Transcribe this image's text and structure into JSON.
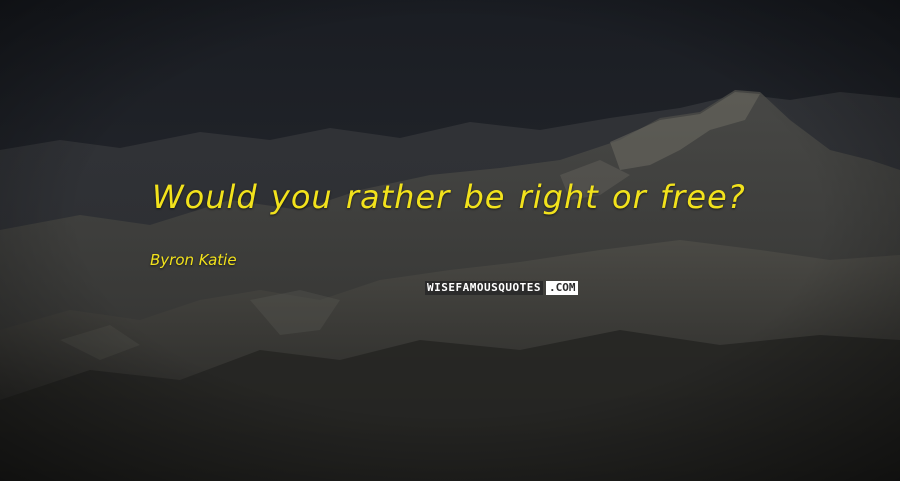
{
  "quote": {
    "text": "Would you rather be right or free?",
    "color": "#f2e21c"
  },
  "author": {
    "name": "Byron Katie",
    "color": "#f2e21c"
  },
  "watermark": {
    "brand": "WISEFAMOUSQUOTES",
    "tld": ".COM",
    "text_color": "#ffffff",
    "highlight_color": "#ffffff",
    "background": "#2b2b2b"
  },
  "background": {
    "description_icon": "mountain-range-photo"
  }
}
